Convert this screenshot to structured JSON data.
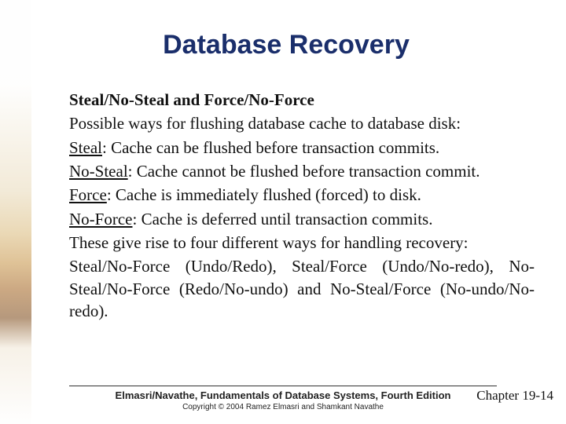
{
  "title": "Database Recovery",
  "heading": "Steal/No-Steal and Force/No-Force",
  "intro": "Possible ways for flushing database cache to database disk:",
  "defs": [
    {
      "label": "Steal",
      "text": ": Cache can be flushed before transaction commits."
    },
    {
      "label": "No-Steal",
      "text": ": Cache cannot be flushed before transaction commit."
    },
    {
      "label": "Force",
      "text": ":  Cache is immediately flushed (forced) to disk."
    },
    {
      "label": "No-Force",
      "text": ":  Cache is deferred until transaction commits."
    }
  ],
  "summary1": "These give rise to four different ways for handling recovery:",
  "summary2": "Steal/No-Force (Undo/Redo), Steal/Force (Undo/No-redo), No-Steal/No-Force (Redo/No-undo) and No-Steal/Force (No-undo/No-redo).",
  "footer": {
    "book": "Elmasri/Navathe, Fundamentals of Database Systems, Fourth Edition",
    "copyright": "Copyright © 2004 Ramez Elmasri and Shamkant Navathe",
    "chapter": "Chapter 19-14"
  }
}
